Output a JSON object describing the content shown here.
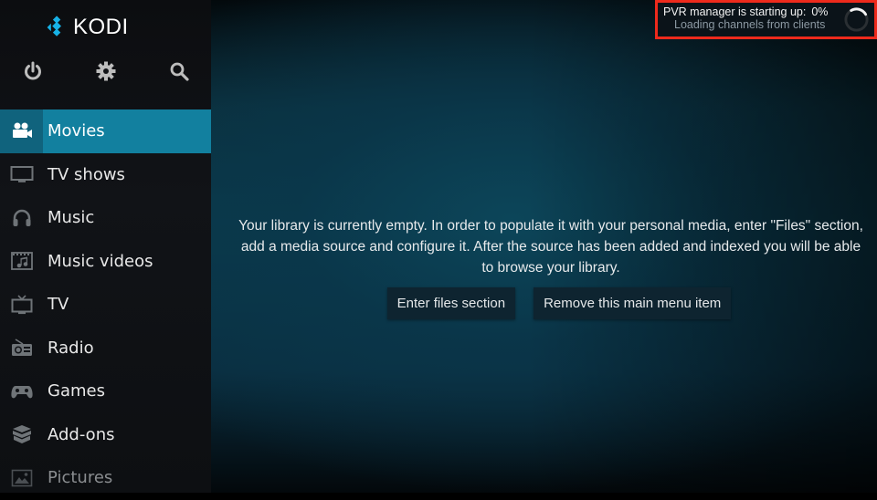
{
  "app": {
    "name": "KODI"
  },
  "top_icons": [
    {
      "name": "power-icon",
      "label": "Power"
    },
    {
      "name": "settings-icon",
      "label": "Settings"
    },
    {
      "name": "search-icon",
      "label": "Search"
    }
  ],
  "menu": {
    "items": [
      {
        "label": "Movies",
        "icon": "movie-camera-icon",
        "selected": true
      },
      {
        "label": "TV shows",
        "icon": "tv-shows-icon"
      },
      {
        "label": "Music",
        "icon": "headphones-icon"
      },
      {
        "label": "Music videos",
        "icon": "music-video-icon"
      },
      {
        "label": "TV",
        "icon": "tv-icon"
      },
      {
        "label": "Radio",
        "icon": "radio-icon"
      },
      {
        "label": "Games",
        "icon": "gamepad-icon"
      },
      {
        "label": "Add-ons",
        "icon": "addons-box-icon"
      },
      {
        "label": "Pictures",
        "icon": "pictures-icon",
        "dimmed": true
      }
    ]
  },
  "content": {
    "message": "Your library is currently empty. In order to populate it with your personal media, enter \"Files\" section, add a media source and configure it. After the source has been added and indexed you will be able to browse your library.",
    "buttons": {
      "enter_files": "Enter files section",
      "remove_item": "Remove this main menu item"
    }
  },
  "pvr_notification": {
    "title": "PVR manager is starting up:",
    "progress_text": "0%",
    "progress": 0,
    "subtitle": "Loading channels from clients"
  },
  "colors": {
    "accent": "#12809f",
    "accent_dark": "#10637d",
    "highlight_border": "#ee2a1c",
    "logo_blue": "#17b2e7"
  }
}
